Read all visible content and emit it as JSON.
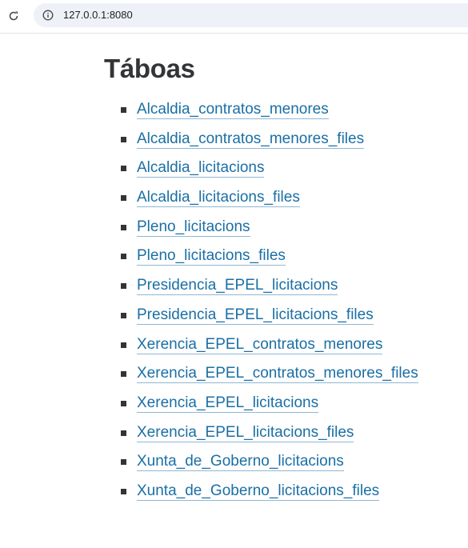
{
  "browser": {
    "url": "127.0.0.1:8080",
    "reload_icon": "reload-icon",
    "info_icon": "info-icon"
  },
  "page": {
    "title": "Táboas",
    "tables": [
      {
        "label": "Alcaldia_contratos_menores"
      },
      {
        "label": "Alcaldia_contratos_menores_files"
      },
      {
        "label": "Alcaldia_licitacions"
      },
      {
        "label": "Alcaldia_licitacions_files"
      },
      {
        "label": "Pleno_licitacions"
      },
      {
        "label": "Pleno_licitacions_files"
      },
      {
        "label": "Presidencia_EPEL_licitacions"
      },
      {
        "label": "Presidencia_EPEL_licitacions_files"
      },
      {
        "label": "Xerencia_EPEL_contratos_menores"
      },
      {
        "label": "Xerencia_EPEL_contratos_menores_files"
      },
      {
        "label": "Xerencia_EPEL_licitacions"
      },
      {
        "label": "Xerencia_EPEL_licitacions_files"
      },
      {
        "label": "Xunta_de_Goberno_licitacions"
      },
      {
        "label": "Xunta_de_Goberno_licitacions_files"
      }
    ]
  },
  "colors": {
    "link": "#1a6fa5",
    "heading": "#333438",
    "omnibox": "#eef1f8"
  }
}
